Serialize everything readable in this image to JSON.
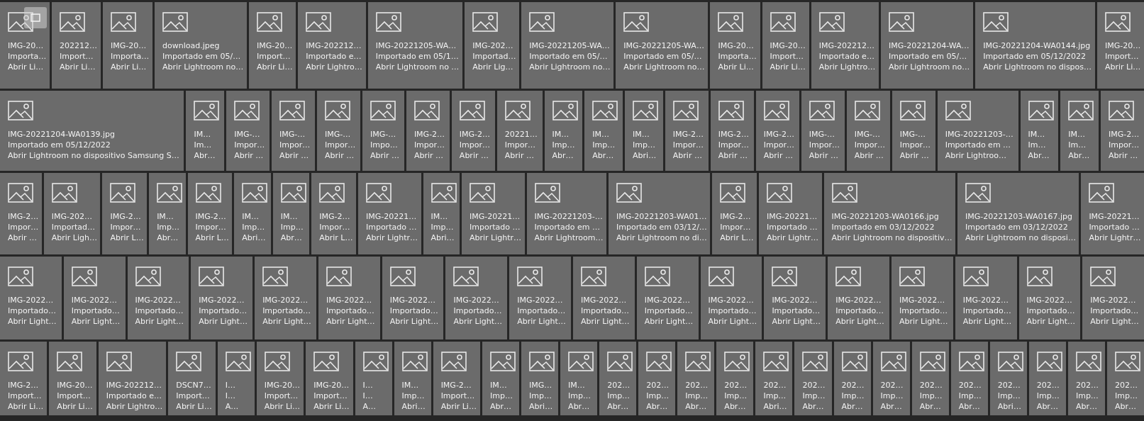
{
  "rows": [
    {
      "tiles": [
        {
          "name": "IMG-20…",
          "imported": "Importa…",
          "device": "Abrir Li…"
        },
        {
          "name": "202212…",
          "imported": "Import…",
          "device": "Abrir Li…"
        },
        {
          "name": "IMG-20…",
          "imported": "Importa…",
          "device": "Abrir Li…"
        },
        {
          "name": "download.jpeg",
          "imported": "Importado em 05/…",
          "device": "Abrir Lightroom no…"
        },
        {
          "name": "IMG-20…",
          "imported": "Import…",
          "device": "Abrir Li…"
        },
        {
          "name": "IMG-202212…",
          "imported": "Importado e…",
          "device": "Abrir Lightro…"
        },
        {
          "name": "IMG-20221205-WA…",
          "imported": "Importado em 05/1…",
          "device": "Abrir Lightroom no …"
        },
        {
          "name": "IMG-202…",
          "imported": "Importad…",
          "device": "Abrir Lig…"
        },
        {
          "name": "IMG-20221205-WA…",
          "imported": "Importado em 05/…",
          "device": "Abrir Lightroom no…"
        },
        {
          "name": "IMG-20221205-WA…",
          "imported": "Importado em 05/…",
          "device": "Abrir Lightroom no…"
        },
        {
          "name": "IMG-20…",
          "imported": "Importa…",
          "device": "Abrir Li…"
        },
        {
          "name": "IMG-20…",
          "imported": "Import…",
          "device": "Abrir Li…"
        },
        {
          "name": "IMG-202212…",
          "imported": "Importado e…",
          "device": "Abrir Lightro…"
        },
        {
          "name": "IMG-20221204-WA…",
          "imported": "Importado em 05/…",
          "device": "Abrir Lightroom no…"
        },
        {
          "name": "IMG-20221204-WA0144.jpg",
          "imported": "Importado em 05/12/2022",
          "device": "Abrir Lightroom no dispos…"
        },
        {
          "name": "IMG-20…",
          "imported": "Import…",
          "device": "Abrir Li…"
        }
      ]
    },
    {
      "tiles": [
        {
          "name": "IMG-20221204-WA0139.jpg",
          "imported": "Importado em 05/12/2022",
          "device": "Abrir Lightroom no dispositivo Samsung S…"
        },
        {
          "name": "IM…",
          "imported": "Im…",
          "device": "Abr…"
        },
        {
          "name": "IMG-…",
          "imported": "Impor…",
          "device": "Abrir …"
        },
        {
          "name": "IMG-…",
          "imported": "Impor…",
          "device": "Abrir …"
        },
        {
          "name": "IMG-…",
          "imported": "Impor…",
          "device": "Abrir …"
        },
        {
          "name": "IMG-…",
          "imported": "Impo…",
          "device": "Abrir …"
        },
        {
          "name": "IMG-2…",
          "imported": "Impor…",
          "device": "Abrir …"
        },
        {
          "name": "IMG-2…",
          "imported": "Impor…",
          "device": "Abrir …"
        },
        {
          "name": "20221…",
          "imported": "Impor…",
          "device": "Abrir …"
        },
        {
          "name": "IM…",
          "imported": "Imp…",
          "device": "Abr…"
        },
        {
          "name": "IM…",
          "imported": "Imp…",
          "device": "Abr…"
        },
        {
          "name": "IM…",
          "imported": "Imp…",
          "device": "Abri…"
        },
        {
          "name": "IMG-2…",
          "imported": "Impor…",
          "device": "Abrir …"
        },
        {
          "name": "IMG-2…",
          "imported": "Impor…",
          "device": "Abrir …"
        },
        {
          "name": "IMG-2…",
          "imported": "Impor…",
          "device": "Abrir …"
        },
        {
          "name": "IMG-…",
          "imported": "Impor…",
          "device": "Abrir …"
        },
        {
          "name": "IMG-…",
          "imported": "Impor…",
          "device": "Abrir …"
        },
        {
          "name": "IMG-…",
          "imported": "Impor…",
          "device": "Abrir …"
        },
        {
          "name": "IMG-20221203-…",
          "imported": "Importado em …",
          "device": "Abrir Lightroo…"
        },
        {
          "name": "IM…",
          "imported": "Im…",
          "device": "Abr…"
        },
        {
          "name": "IM…",
          "imported": "Im…",
          "device": "Abr…"
        },
        {
          "name": "IMG-2…",
          "imported": "Impor…",
          "device": "Abrir …"
        }
      ]
    },
    {
      "tiles": [
        {
          "name": "IMG-2…",
          "imported": "Impor…",
          "device": "Abrir …"
        },
        {
          "name": "IMG-202…",
          "imported": "Importad…",
          "device": "Abrir Ligh…"
        },
        {
          "name": "IMG-2…",
          "imported": "Impor…",
          "device": "Abrir L…"
        },
        {
          "name": "IM…",
          "imported": "Imp…",
          "device": "Abr…"
        },
        {
          "name": "IMG-2…",
          "imported": "Impor…",
          "device": "Abrir L…"
        },
        {
          "name": "IM…",
          "imported": "Imp…",
          "device": "Abri…"
        },
        {
          "name": "IM…",
          "imported": "Imp…",
          "device": "Abr…"
        },
        {
          "name": "IMG-2…",
          "imported": "Impor…",
          "device": "Abrir L…"
        },
        {
          "name": "IMG-20221…",
          "imported": "Importado …",
          "device": "Abrir Lightr…"
        },
        {
          "name": "IM…",
          "imported": "Imp…",
          "device": "Abri…"
        },
        {
          "name": "IMG-20221…",
          "imported": "Importado …",
          "device": "Abrir Lightr…"
        },
        {
          "name": "IMG-20221203-…",
          "imported": "Importado em …",
          "device": "Abrir Lightroom…"
        },
        {
          "name": "IMG-20221203-WA01…",
          "imported": "Importado em 03/12/…",
          "device": "Abrir Lightroom no di…"
        },
        {
          "name": "IMG-2…",
          "imported": "Impor…",
          "device": "Abrir L…"
        },
        {
          "name": "IMG-20221…",
          "imported": "Importado …",
          "device": "Abrir Lightr…"
        },
        {
          "name": "IMG-20221203-WA0166.jpg",
          "imported": "Importado em 03/12/2022",
          "device": "Abrir Lightroom no dispositiv…"
        },
        {
          "name": "IMG-20221203-WA0167.jpg",
          "imported": "Importado em 03/12/2022",
          "device": "Abrir Lightroom no disposi…"
        },
        {
          "name": "IMG-20221…",
          "imported": "Importado …",
          "device": "Abrir Lightr…"
        }
      ]
    },
    {
      "tiles": [
        {
          "name": "IMG-2022…",
          "imported": "Importado…",
          "device": "Abrir Light…"
        },
        {
          "name": "IMG-2022…",
          "imported": "Importado…",
          "device": "Abrir Light…"
        },
        {
          "name": "IMG-2022…",
          "imported": "Importado…",
          "device": "Abrir Light…"
        },
        {
          "name": "IMG-2022…",
          "imported": "Importado…",
          "device": "Abrir Light…"
        },
        {
          "name": "IMG-2022…",
          "imported": "Importado…",
          "device": "Abrir Light…"
        },
        {
          "name": "IMG-2022…",
          "imported": "Importado…",
          "device": "Abrir Light…"
        },
        {
          "name": "IMG-2022…",
          "imported": "Importado…",
          "device": "Abrir Light…"
        },
        {
          "name": "IMG-2022…",
          "imported": "Importado…",
          "device": "Abrir Light…"
        },
        {
          "name": "IMG-2022…",
          "imported": "Importado…",
          "device": "Abrir Light…"
        },
        {
          "name": "IMG-2022…",
          "imported": "Importado…",
          "device": "Abrir Light…"
        },
        {
          "name": "IMG-2022…",
          "imported": "Importado…",
          "device": "Abrir Light…"
        },
        {
          "name": "IMG-2022…",
          "imported": "Importado…",
          "device": "Abrir Light…"
        },
        {
          "name": "IMG-2022…",
          "imported": "Importado…",
          "device": "Abrir Light…"
        },
        {
          "name": "IMG-2022…",
          "imported": "Importado…",
          "device": "Abrir Light…"
        },
        {
          "name": "IMG-2022…",
          "imported": "Importado…",
          "device": "Abrir Light…"
        },
        {
          "name": "IMG-2022…",
          "imported": "Importado…",
          "device": "Abrir Light…"
        },
        {
          "name": "IMG-2022…",
          "imported": "Importado…",
          "device": "Abrir Light…"
        },
        {
          "name": "IMG-2022…",
          "imported": "Importado…",
          "device": "Abrir Light…"
        }
      ]
    },
    {
      "tiles": [
        {
          "name": "IMG-2…",
          "imported": "Import…",
          "device": "Abrir Li…"
        },
        {
          "name": "IMG-20…",
          "imported": "Import…",
          "device": "Abrir Li…"
        },
        {
          "name": "IMG-202212…",
          "imported": "Importado e…",
          "device": "Abrir Lightro…"
        },
        {
          "name": "DSCN7…",
          "imported": "Import…",
          "device": "Abrir Li…"
        },
        {
          "name": "I…",
          "imported": "I…",
          "device": "A…"
        },
        {
          "name": "IMG-20…",
          "imported": "Import…",
          "device": "Abrir Li…"
        },
        {
          "name": "IMG-20…",
          "imported": "Import…",
          "device": "Abrir Li…"
        },
        {
          "name": "I…",
          "imported": "I…",
          "device": "A…"
        },
        {
          "name": "IM…",
          "imported": "Imp…",
          "device": "Abri…"
        },
        {
          "name": "IMG-2…",
          "imported": "Import…",
          "device": "Abrir Li…"
        },
        {
          "name": "IM…",
          "imported": "Imp…",
          "device": "Abr…"
        },
        {
          "name": "IMG…",
          "imported": "Imp…",
          "device": "Abri…"
        },
        {
          "name": "IM…",
          "imported": "Imp…",
          "device": "Abr…"
        },
        {
          "name": "202…",
          "imported": "Imp…",
          "device": "Abr…"
        },
        {
          "name": "202…",
          "imported": "Imp…",
          "device": "Abr…"
        },
        {
          "name": "202…",
          "imported": "Imp…",
          "device": "Abr…"
        },
        {
          "name": "202…",
          "imported": "Imp…",
          "device": "Abr…"
        },
        {
          "name": "202…",
          "imported": "Imp…",
          "device": "Abri…"
        },
        {
          "name": "202…",
          "imported": "Imp…",
          "device": "Abr…"
        },
        {
          "name": "202…",
          "imported": "Imp…",
          "device": "Abr…"
        },
        {
          "name": "202…",
          "imported": "Imp…",
          "device": "Abr…"
        },
        {
          "name": "202…",
          "imported": "Imp…",
          "device": "Abr…"
        },
        {
          "name": "202…",
          "imported": "Imp…",
          "device": "Abr…"
        },
        {
          "name": "202…",
          "imported": "Imp…",
          "device": "Abri…"
        },
        {
          "name": "202…",
          "imported": "Imp…",
          "device": "Abr…"
        },
        {
          "name": "202…",
          "imported": "Imp…",
          "device": "Abr…"
        },
        {
          "name": "202…",
          "imported": "Imp…",
          "device": "Abr…"
        }
      ]
    }
  ]
}
